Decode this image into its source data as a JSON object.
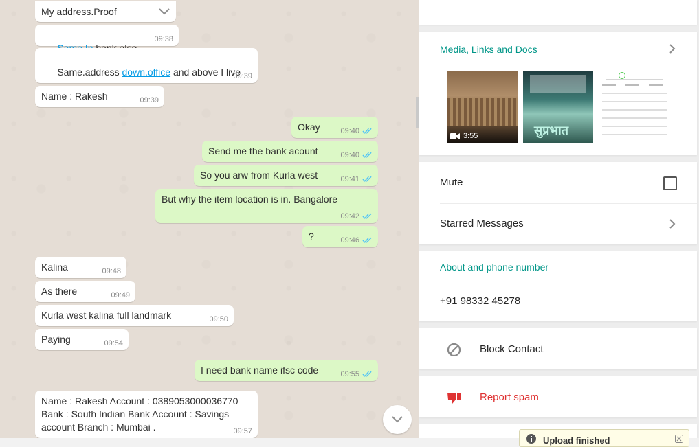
{
  "chat": {
    "messages": [
      {
        "dir": "in",
        "text": "My address.Proof",
        "time": ""
      },
      {
        "dir": "in",
        "link": "Same.In",
        "text": " bank also",
        "time": "09:38"
      },
      {
        "dir": "in",
        "pre": "Same.address ",
        "link": "down.office",
        "post": " and above I live",
        "time": "09:39"
      },
      {
        "dir": "in",
        "text": "Name : Rakesh",
        "time": "09:39"
      },
      {
        "dir": "out",
        "text": "Okay",
        "time": "09:40"
      },
      {
        "dir": "out",
        "text": "Send me the bank acount",
        "time": "09:40"
      },
      {
        "dir": "out",
        "text": "So you arw from Kurla west",
        "time": "09:41"
      },
      {
        "dir": "out",
        "text": "But why the item location is in. Bangalore",
        "time": "09:42"
      },
      {
        "dir": "out",
        "text": "?",
        "time": "09:46"
      },
      {
        "dir": "in",
        "text": "Kalina",
        "time": "09:48"
      },
      {
        "dir": "in",
        "text": "As there",
        "time": "09:49"
      },
      {
        "dir": "in",
        "text": "Kurla west kalina full landmark",
        "time": "09:50"
      },
      {
        "dir": "in",
        "text": "Paying",
        "time": "09:54"
      },
      {
        "dir": "out",
        "text": "I need bank name ifsc code",
        "time": "09:55"
      },
      {
        "dir": "in",
        "text": "Name : Rakesh Account : 0389053000036770\nBank : South Indian Bank Account : Savings\naccount Branch : Mumbai .",
        "time": "09:57"
      }
    ],
    "icons": {
      "read_ticks": "double-check-icon",
      "menu_chevron": "chevron-down-icon",
      "scroll_down": "chevron-down-icon"
    },
    "colors": {
      "incoming": "#ffffff",
      "outgoing": "#dcf8c6",
      "ticks": "#4fc3f7"
    }
  },
  "info": {
    "media_title": "Media, Links and Docs",
    "media": [
      {
        "kind": "video",
        "duration": "3:55"
      },
      {
        "kind": "image",
        "caption": "सुप्रभात"
      },
      {
        "kind": "document"
      }
    ],
    "mute_label": "Mute",
    "starred_label": "Starred Messages",
    "about_title": "About and phone number",
    "phone": "+91 98332 45278",
    "block_label": "Block Contact",
    "report_label": "Report spam",
    "colors": {
      "accent": "#009688",
      "danger": "#df3333"
    }
  },
  "toast": {
    "text": "Upload finished"
  }
}
